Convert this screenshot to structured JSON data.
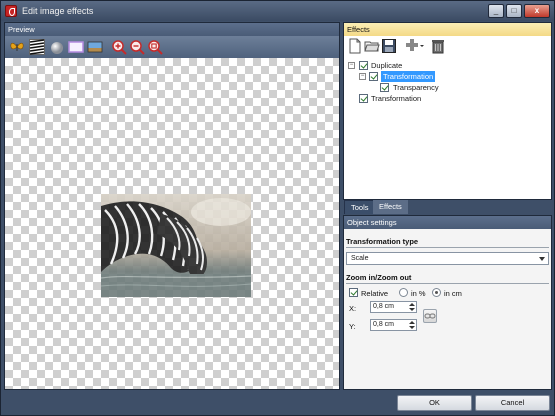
{
  "window": {
    "title": "Edit image effects",
    "minimize": "_",
    "maximize": "□",
    "close": "x"
  },
  "preview": {
    "header": "Preview",
    "toolbar": [
      {
        "name": "butterfly-icon"
      },
      {
        "name": "zebra-icon"
      },
      {
        "name": "sphere-icon"
      },
      {
        "name": "frame-icon"
      },
      {
        "name": "landscape-icon"
      },
      {
        "name": "zoom-in-icon"
      },
      {
        "name": "zoom-out-icon"
      },
      {
        "name": "zoom-fit-icon"
      }
    ]
  },
  "effects": {
    "header": "Effects",
    "toolbar": [
      {
        "name": "new-icon"
      },
      {
        "name": "open-icon"
      },
      {
        "name": "save-icon"
      },
      {
        "name": "add-effect-icon"
      },
      {
        "name": "delete-icon"
      }
    ],
    "tree": [
      {
        "label": "Duplicate",
        "expander": "−",
        "checked": true
      },
      {
        "label": "Transformation",
        "expander": "−",
        "checked": true,
        "selected": true
      },
      {
        "label": "Transparency",
        "checked": true
      },
      {
        "label": "Transformation",
        "checked": true
      }
    ]
  },
  "tabs": [
    {
      "label": "Tools"
    },
    {
      "label": "Effects"
    }
  ],
  "settings": {
    "header": "Object settings",
    "transformation_type_title": "Transformation type",
    "transformation_type_value": "Scale",
    "zoom_title": "Zoom in/Zoom out",
    "relative_label": "Relative",
    "relative_checked": true,
    "unit_percent": "in %",
    "unit_cm": "in cm",
    "unit_selected": "in cm",
    "x_label": "X:",
    "x_value": "0,8 cm",
    "y_label": "Y:",
    "y_value": "0,8 cm"
  },
  "buttons": {
    "ok": "OK",
    "cancel": "Cancel"
  }
}
